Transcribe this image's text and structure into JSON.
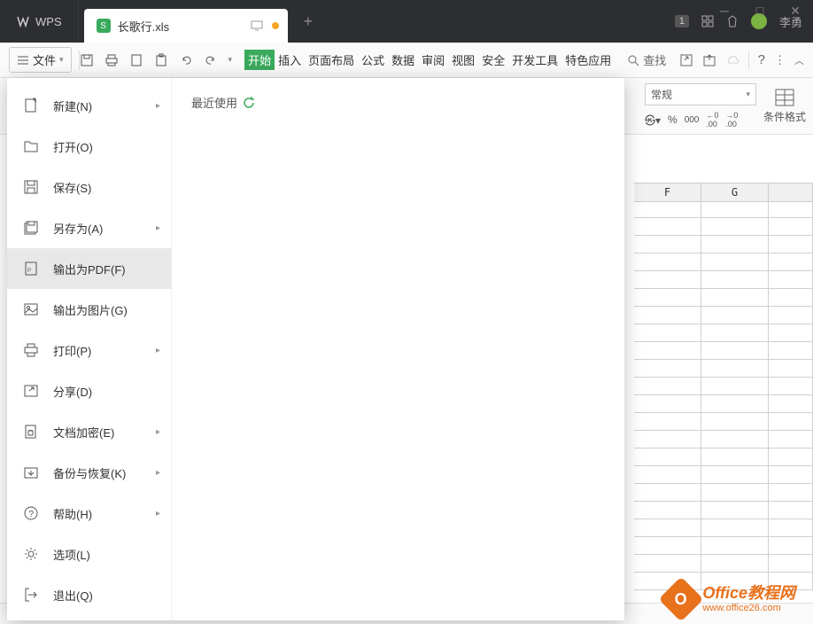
{
  "titlebar": {
    "app_name": "WPS",
    "file_tab": "长歌行.xls",
    "badge": "1",
    "user_name": "李勇"
  },
  "toolbar": {
    "file_button": "文件",
    "ribbon_tabs": [
      "开始",
      "插入",
      "页面布局",
      "公式",
      "数据",
      "审阅",
      "视图",
      "安全",
      "开发工具",
      "特色应用"
    ],
    "search_label": "查找"
  },
  "format": {
    "select_value": "常规",
    "cond_format": "条件格式"
  },
  "columns": [
    "F",
    "G"
  ],
  "file_menu": {
    "items": [
      {
        "label": "新建(N)",
        "has_arrow": true,
        "icon": "new"
      },
      {
        "label": "打开(O)",
        "has_arrow": false,
        "icon": "folder"
      },
      {
        "label": "保存(S)",
        "has_arrow": false,
        "icon": "save"
      },
      {
        "label": "另存为(A)",
        "has_arrow": true,
        "icon": "saveas"
      },
      {
        "label": "输出为PDF(F)",
        "has_arrow": false,
        "icon": "pdf",
        "selected": true
      },
      {
        "label": "输出为图片(G)",
        "has_arrow": false,
        "icon": "image"
      },
      {
        "label": "打印(P)",
        "has_arrow": true,
        "icon": "print"
      },
      {
        "label": "分享(D)",
        "has_arrow": false,
        "icon": "share"
      },
      {
        "label": "文档加密(E)",
        "has_arrow": true,
        "icon": "lock"
      },
      {
        "label": "备份与恢复(K)",
        "has_arrow": true,
        "icon": "backup"
      },
      {
        "label": "帮助(H)",
        "has_arrow": true,
        "icon": "help"
      },
      {
        "label": "选项(L)",
        "has_arrow": false,
        "icon": "settings"
      },
      {
        "label": "退出(Q)",
        "has_arrow": false,
        "icon": "exit"
      }
    ],
    "recent_label": "最近使用"
  },
  "watermark": {
    "title": "Office教程网",
    "url": "www.office26.com"
  }
}
